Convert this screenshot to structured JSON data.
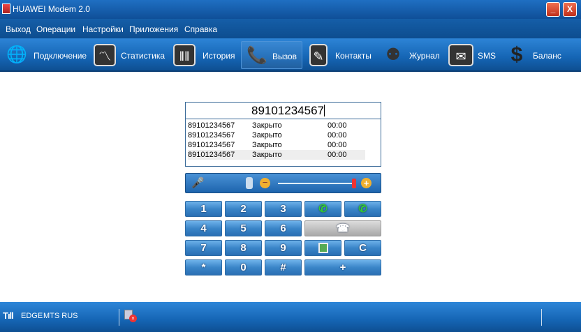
{
  "window": {
    "title": "HUAWEI Modem 2.0",
    "minimize": "_",
    "close": "X"
  },
  "menu": [
    "Выход",
    "Операции",
    "Настройки",
    "Приложения",
    "Справка"
  ],
  "toolbar": [
    {
      "label": "Подключение",
      "icon": "globe-icon"
    },
    {
      "label": "Статистика",
      "icon": "chart-icon"
    },
    {
      "label": "История",
      "icon": "history-icon"
    },
    {
      "label": "Вызов",
      "icon": "phone-icon",
      "active": true
    },
    {
      "label": "Контакты",
      "icon": "pen-icon"
    },
    {
      "label": "Журнал",
      "icon": "people-icon"
    },
    {
      "label": "SMS",
      "icon": "envelope-icon"
    },
    {
      "label": "Баланс",
      "icon": "dollar-icon"
    }
  ],
  "dialer": {
    "number": "89101234567",
    "log": [
      {
        "number": "89101234567",
        "status": "Закрыто",
        "duration": "00:00"
      },
      {
        "number": "89101234567",
        "status": "Закрыто",
        "duration": "00:00"
      },
      {
        "number": "89101234567",
        "status": "Закрыто",
        "duration": "00:00"
      },
      {
        "number": "89101234567",
        "status": "Закрыто",
        "duration": "00:00"
      }
    ],
    "volume_percent": 100
  },
  "keypad": {
    "k1": "1",
    "k2": "2",
    "k3": "3",
    "k4": "4",
    "k5": "5",
    "k6": "6",
    "k7": "7",
    "k8": "8",
    "k9": "9",
    "kstar": "*",
    "k0": "0",
    "khash": "#",
    "clear": "C",
    "plus": "+"
  },
  "status": {
    "network": "EDGE",
    "operator": "MTS RUS"
  }
}
